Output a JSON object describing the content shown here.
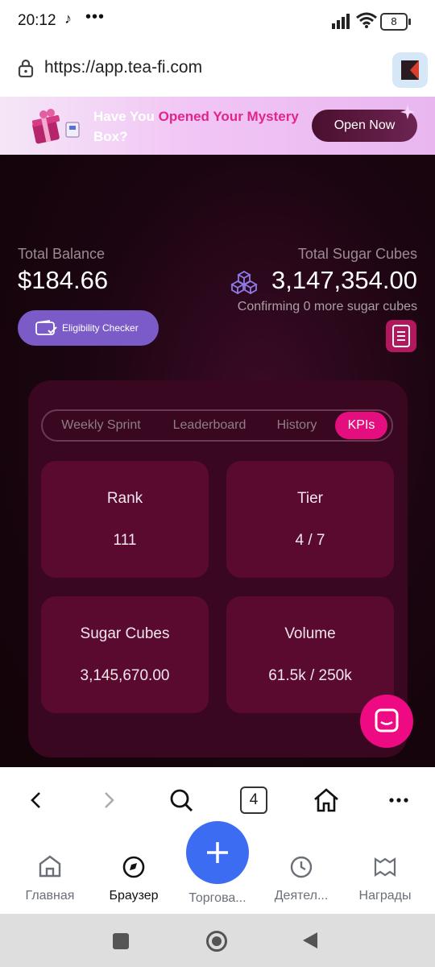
{
  "status_bar": {
    "time": "20:12",
    "battery": "8"
  },
  "address_bar": {
    "url": "https://app.tea-fi.com"
  },
  "banner": {
    "text_1": "Have You ",
    "text_2": "Opened Your",
    "text_3": " ",
    "text_4": "Mystery",
    "text_5": " Box?",
    "button": "Open Now"
  },
  "balance": {
    "total_balance_label": "Total Balance",
    "total_balance_value": "$184.66",
    "sugar_label": "Total Sugar Cubes",
    "sugar_value": "3,147,354.00",
    "confirming": "Confirming 0 more sugar cubes",
    "eligibility_button": "Eligibility Checker"
  },
  "tabs": [
    {
      "label": "Weekly Sprint",
      "active": false
    },
    {
      "label": "Leaderboard",
      "active": false
    },
    {
      "label": "History",
      "active": false
    },
    {
      "label": "KPIs",
      "active": true
    }
  ],
  "kpis": [
    {
      "label": "Rank",
      "value": "111"
    },
    {
      "label": "Tier",
      "value": "4 / 7"
    },
    {
      "label": "Sugar Cubes",
      "value": "3,145,670.00"
    },
    {
      "label": "Volume",
      "value": "61.5k / 250k"
    }
  ],
  "browser_nav": {
    "tab_count": "4"
  },
  "bottom_tabs": [
    {
      "label": "Главная",
      "icon": "home-icon"
    },
    {
      "label": "Браузер",
      "icon": "compass-icon",
      "active": true
    },
    {
      "label": "Торгова...",
      "icon": "plus-icon"
    },
    {
      "label": "Деятел...",
      "icon": "clock-icon"
    },
    {
      "label": "Награды",
      "icon": "gift-box-icon"
    }
  ],
  "colors": {
    "accent_pink": "#e50e7f",
    "eligibility_purple": "#7a5bc8",
    "fab_blue": "#3c6cf2"
  }
}
